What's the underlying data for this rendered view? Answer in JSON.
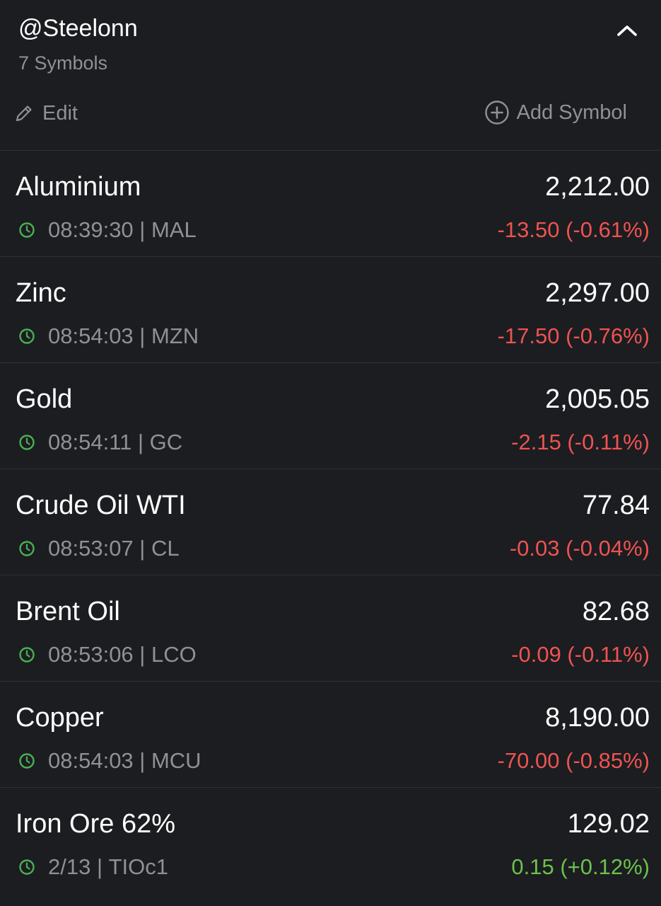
{
  "header": {
    "title": "@Steelonn",
    "symbol_count": "7 Symbols",
    "collapse_icon": "chevron-up-icon",
    "edit_label": "Edit",
    "edit_icon": "pencil-icon",
    "add_label": "Add Symbol",
    "add_icon": "plus-circle-icon"
  },
  "colors": {
    "background": "#1b1d21",
    "negative": "#ef5350",
    "positive": "#6cc24a",
    "market_open_clock": "#4caf50",
    "secondary_text": "#8f9196"
  },
  "symbols": [
    {
      "name": "Aluminium",
      "price": "2,212.00",
      "time": "08:39:30",
      "ticker": "MAL",
      "change": "-13.50 (-0.61%)",
      "direction": "negative"
    },
    {
      "name": "Zinc",
      "price": "2,297.00",
      "time": "08:54:03",
      "ticker": "MZN",
      "change": "-17.50 (-0.76%)",
      "direction": "negative"
    },
    {
      "name": "Gold",
      "price": "2,005.05",
      "time": "08:54:11",
      "ticker": "GC",
      "change": "-2.15 (-0.11%)",
      "direction": "negative"
    },
    {
      "name": "Crude Oil WTI",
      "price": "77.84",
      "time": "08:53:07",
      "ticker": "CL",
      "change": "-0.03 (-0.04%)",
      "direction": "negative"
    },
    {
      "name": "Brent Oil",
      "price": "82.68",
      "time": "08:53:06",
      "ticker": "LCO",
      "change": "-0.09 (-0.11%)",
      "direction": "negative"
    },
    {
      "name": "Copper",
      "price": "8,190.00",
      "time": "08:54:03",
      "ticker": "MCU",
      "change": "-70.00 (-0.85%)",
      "direction": "negative"
    },
    {
      "name": "Iron Ore 62%",
      "price": "129.02",
      "time": "2/13",
      "ticker": "TIOc1",
      "change": "0.15 (+0.12%)",
      "direction": "positive"
    }
  ]
}
